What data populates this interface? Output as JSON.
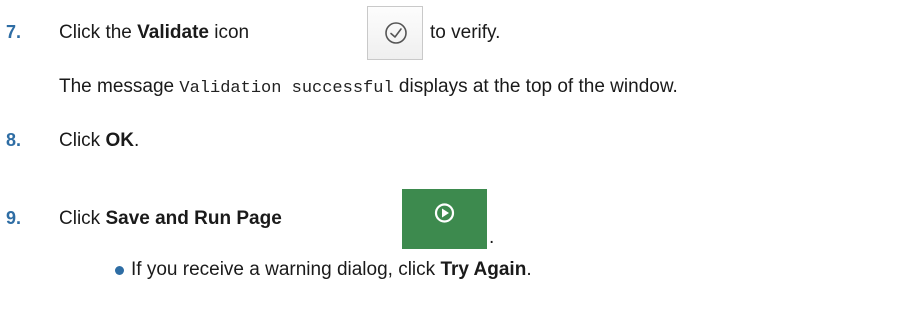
{
  "steps": [
    {
      "number": "7.",
      "pre": "Click the ",
      "bold": "Validate",
      "mid": " icon",
      "post": " to verify.",
      "icon": "check-circle-icon",
      "message_pre": "The message ",
      "message_code": "Validation successful",
      "message_post": " displays at the top of the window."
    },
    {
      "number": "8.",
      "pre": "Click ",
      "bold": "OK",
      "post": "."
    },
    {
      "number": "9.",
      "pre": "Click ",
      "bold": "Save and Run Page",
      "post": ".",
      "icon": "play-circle-icon",
      "sub_bullet": {
        "pre": "If you receive a warning dialog, click ",
        "bold": "Try Again",
        "post": "."
      }
    }
  ],
  "colors": {
    "step_number": "#2e6da4",
    "run_button_bg": "#3d8a4e",
    "validate_icon_stroke": "#555555"
  }
}
